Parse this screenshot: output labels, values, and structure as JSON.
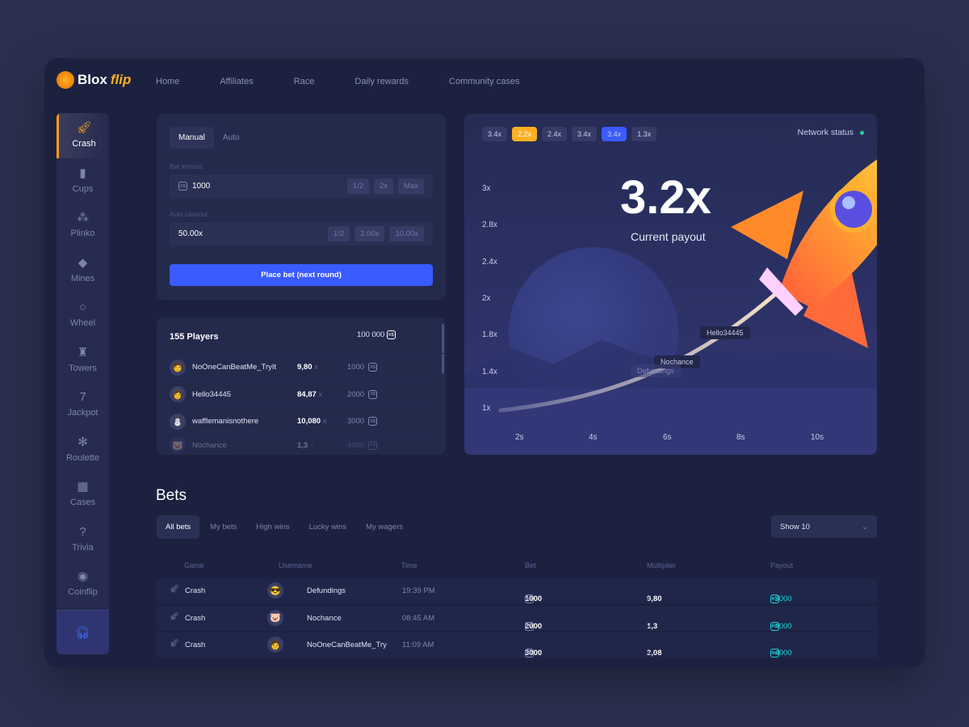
{
  "brand": {
    "name_a": "Blox",
    "name_b": "flip"
  },
  "nav": [
    "Home",
    "Affiliates",
    "Race",
    "Daily rewards",
    "Community cases"
  ],
  "sidebar": [
    {
      "label": "Crash",
      "icon": "rocket-icon",
      "active": true
    },
    {
      "label": "Cups",
      "icon": "cup-icon"
    },
    {
      "label": "Plinko",
      "icon": "plinko-icon"
    },
    {
      "label": "Mines",
      "icon": "diamond-icon"
    },
    {
      "label": "Wheel",
      "icon": "wheel-icon"
    },
    {
      "label": "Towers",
      "icon": "tower-icon"
    },
    {
      "label": "Jackpot",
      "icon": "seven-icon"
    },
    {
      "label": "Roulette",
      "icon": "roulette-icon"
    },
    {
      "label": "Cases",
      "icon": "case-icon"
    },
    {
      "label": "Trivia",
      "icon": "question-icon"
    },
    {
      "label": "Coinflip",
      "icon": "coin-icon"
    }
  ],
  "support_icon": "headset-icon",
  "betpanel": {
    "tabs": [
      "Manual",
      "Auto"
    ],
    "bet_label": "Bet amount",
    "bet_value": "1000",
    "bet_chips": [
      "1/2",
      "2x",
      "Max"
    ],
    "cashout_label": "Auto cashout",
    "cashout_value": "50.00x",
    "cashout_chips": [
      "1/2",
      "2.00x",
      "10.00x"
    ],
    "place": "Place bet (next round)"
  },
  "players": {
    "title": "155 Players",
    "total": "100 000",
    "rows": [
      {
        "name": "NoOneCanBeatMe_TryIt",
        "mult": "9,80",
        "bet": "1000"
      },
      {
        "name": "Hello34445",
        "mult": "84,87",
        "bet": "2000"
      },
      {
        "name": "wafflemanisnothere",
        "mult": "10,080",
        "bet": "3000"
      },
      {
        "name": "Nochance",
        "mult": "1,3",
        "bet": "4000"
      }
    ]
  },
  "coin_label": "R$",
  "mult_suffix": "x",
  "game": {
    "history": [
      "3.4x",
      "2.2x",
      "2.4x",
      "3.4x",
      "3.4x",
      "1.3x"
    ],
    "history_colors": [
      "#353b66",
      "#ffb020",
      "#353b66",
      "#353b66",
      "#3a5bff",
      "#353b66"
    ],
    "network": "Network status",
    "network_color": "#2ecc9a",
    "payout": "3.2x",
    "payout_label": "Current payout",
    "y_ticks": [
      "3x",
      "2.8x",
      "2.4x",
      "2x",
      "1.8x",
      "1.4x",
      "1x"
    ],
    "x_ticks": [
      "2s",
      "4s",
      "6s",
      "8s",
      "10s"
    ],
    "tags": [
      "Hello34445",
      "Nochance",
      "Defundings"
    ]
  },
  "bets": {
    "title": "Bets",
    "tabs": [
      "All bets",
      "My bets",
      "High wins",
      "Lucky wins",
      "My wagers"
    ],
    "show": "Show 10",
    "columns": [
      "Game",
      "Username",
      "Time",
      "Bet",
      "Multiplier",
      "Payout"
    ],
    "rows": [
      {
        "game": "Crash",
        "user": "Defundings",
        "time": "19:39 PM",
        "bet": "1000",
        "mult": "9,80",
        "payout": "+3000"
      },
      {
        "game": "Crash",
        "user": "Nochance",
        "time": "08:45 AM",
        "bet": "2000",
        "mult": "1,3",
        "payout": "+4000"
      },
      {
        "game": "Crash",
        "user": "NoOneCanBeatMe_Try",
        "time": "11:09 AM",
        "bet": "3000",
        "mult": "2,08",
        "payout": "+4000"
      }
    ]
  },
  "payout_color": "#19d3d3"
}
